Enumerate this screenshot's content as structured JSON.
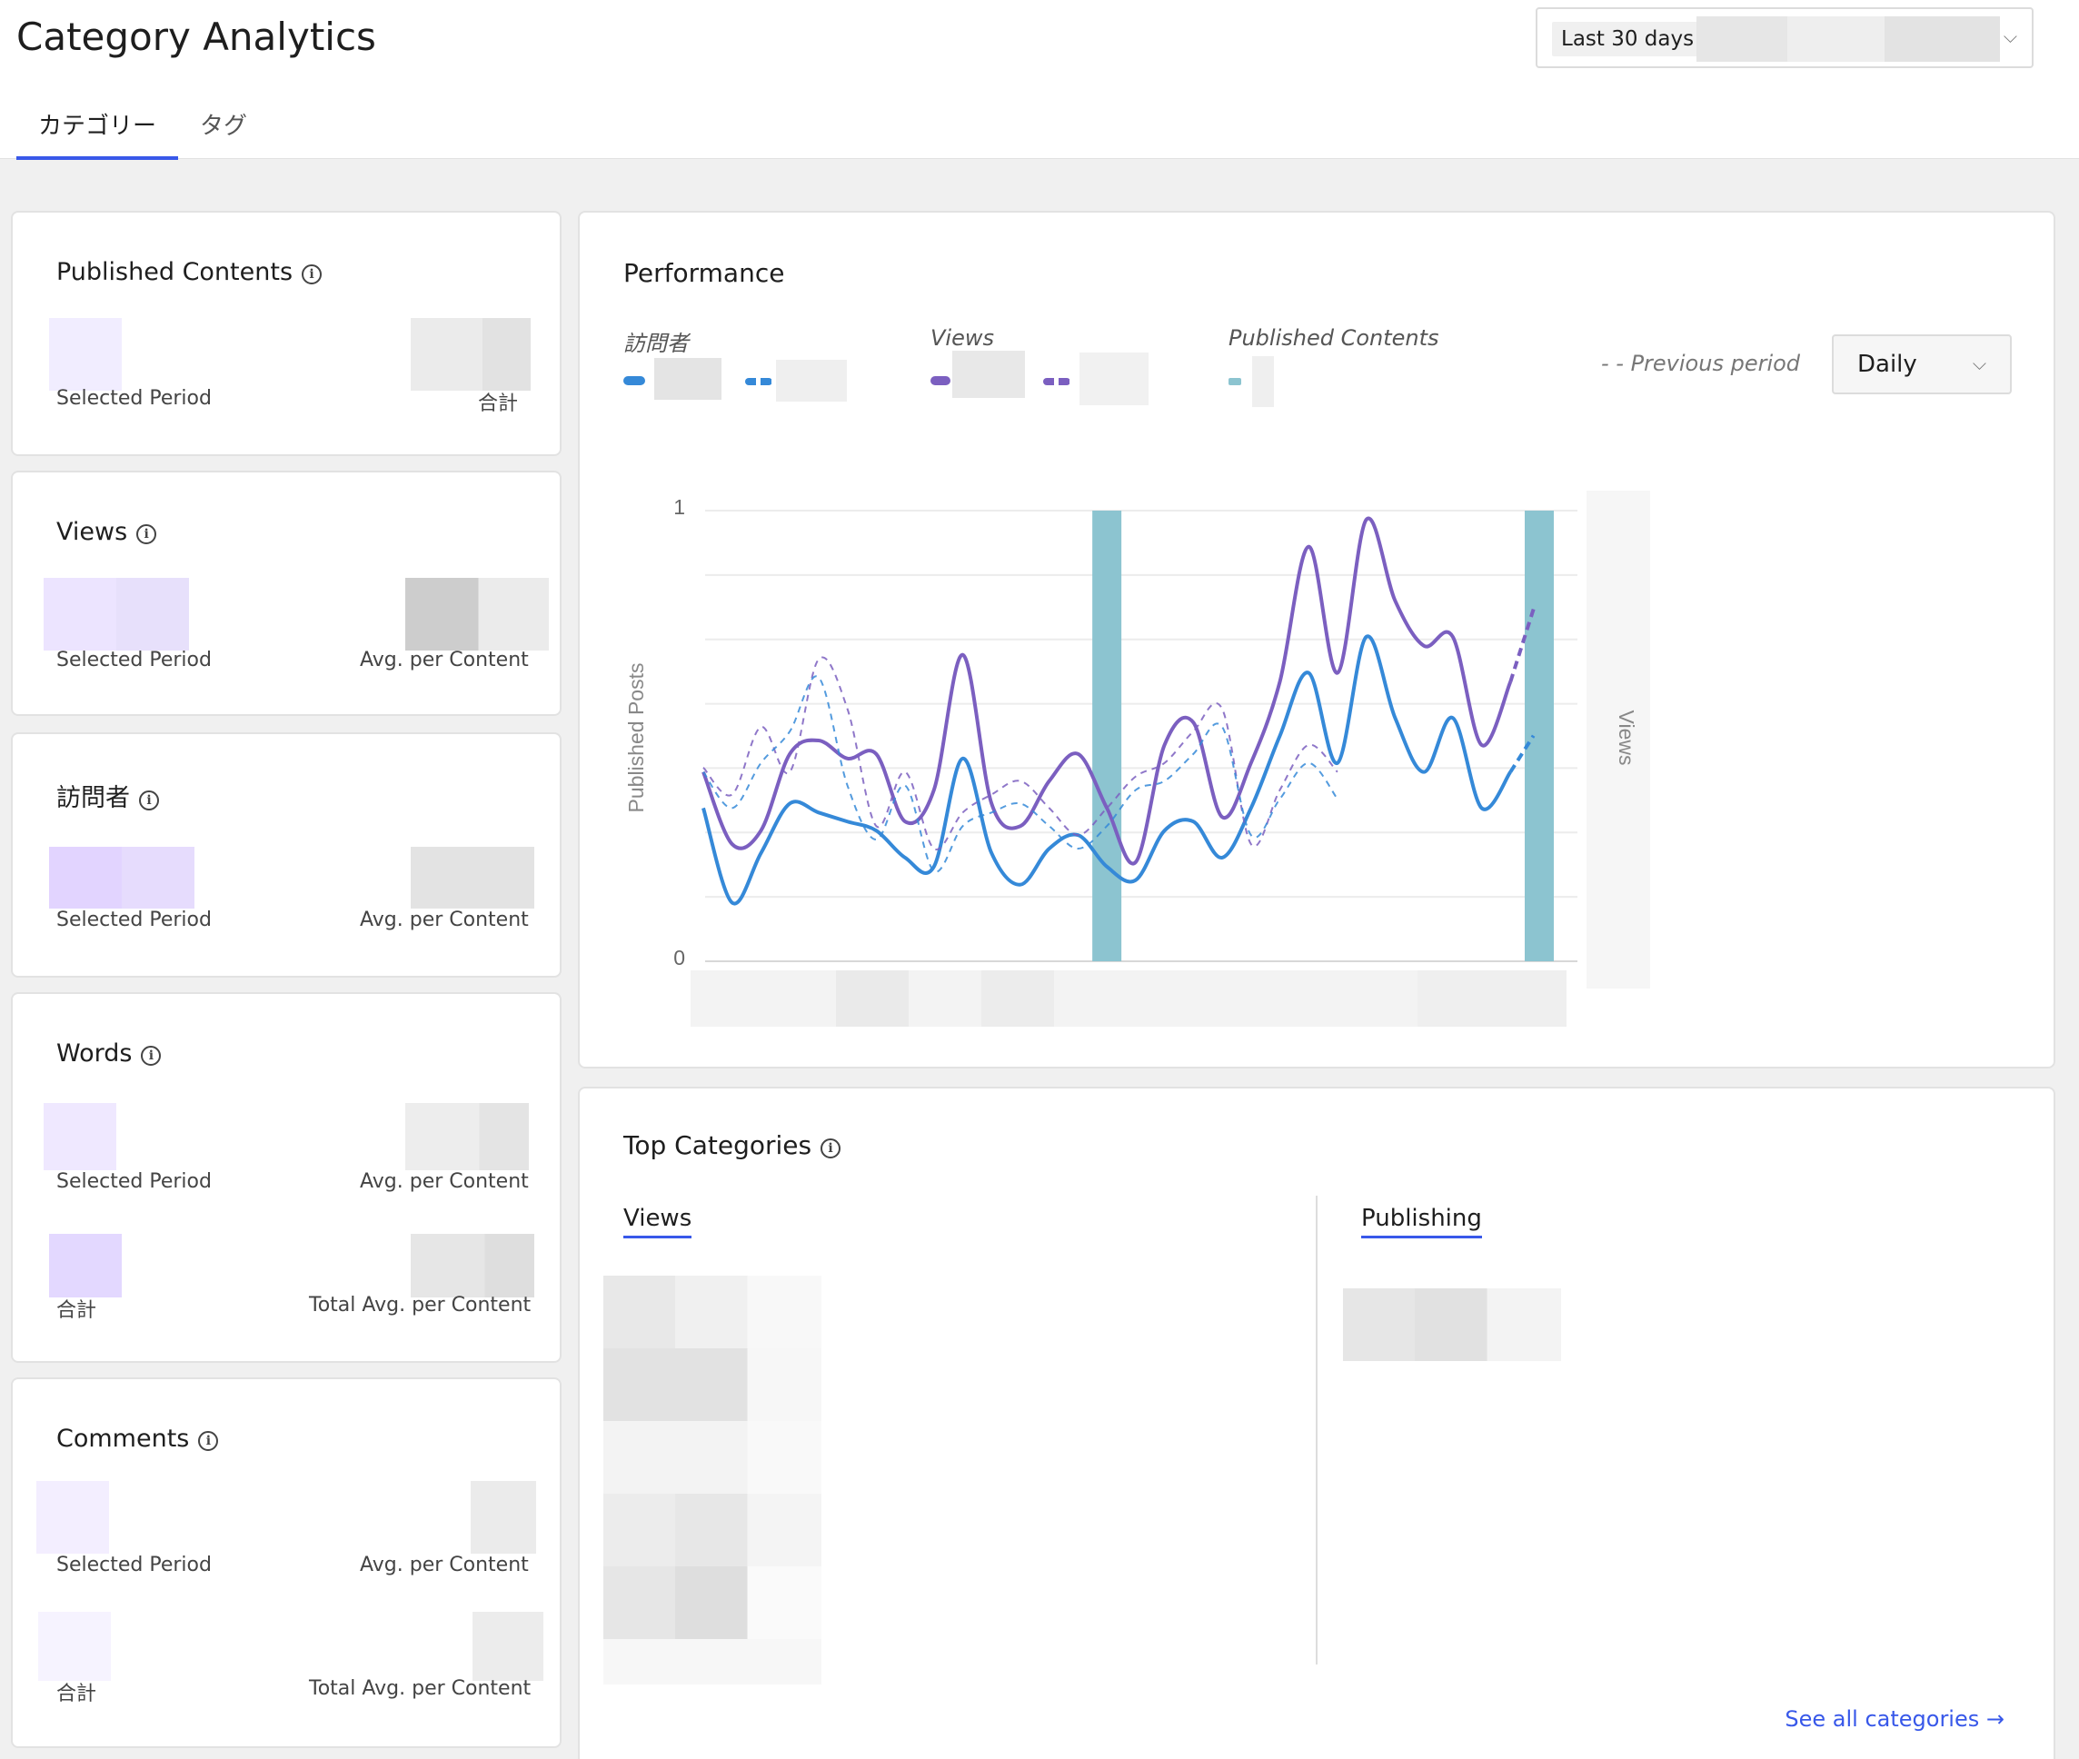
{
  "header": {
    "title": "Category Analytics",
    "date_range": {
      "chip": "Last 30 days",
      "chevron_icon": "chevron-down-icon"
    },
    "tabs": [
      {
        "label": "カテゴリー",
        "active": true
      },
      {
        "label": "タグ",
        "active": false
      }
    ]
  },
  "cards": {
    "published_contents": {
      "title": "Published Contents",
      "info_icon": "info-icon",
      "labels": {
        "left": "Selected Period",
        "right": "合計"
      }
    },
    "views": {
      "title": "Views",
      "info_icon": "info-icon",
      "labels": {
        "left": "Selected Period",
        "right": "Avg. per Content"
      }
    },
    "visitors": {
      "title": "訪問者",
      "info_icon": "info-icon",
      "labels": {
        "left": "Selected Period",
        "right": "Avg. per Content"
      }
    },
    "words": {
      "title": "Words",
      "info_icon": "info-icon",
      "labels": {
        "left1": "Selected Period",
        "right1": "Avg. per Content",
        "left2": "合計",
        "right2": "Total Avg. per Content"
      }
    },
    "comments": {
      "title": "Comments",
      "info_icon": "info-icon",
      "labels": {
        "left1": "Selected Period",
        "right1": "Avg. per Content",
        "left2": "合計",
        "right2": "Total Avg. per Content"
      }
    }
  },
  "performance": {
    "title": "Performance",
    "legend": {
      "visitors": "訪問者",
      "views": "Views",
      "published": "Published Contents",
      "previous_period": "- -  Previous period"
    },
    "period_select": {
      "value": "Daily",
      "chevron_icon": "chevron-down-icon"
    },
    "colors": {
      "visitors": "#3589d8",
      "views": "#7b5fc0",
      "published": "#8cc4d0"
    }
  },
  "chart_data": {
    "type": "line",
    "ylabel": "Published Posts",
    "y2label": "Views",
    "ylim": [
      0,
      1
    ],
    "ytick_labels": [
      "0",
      "1"
    ],
    "grid": true,
    "x": [
      0,
      1,
      2,
      3,
      4,
      5,
      6,
      7,
      8,
      9,
      10,
      11,
      12,
      13,
      14,
      15,
      16,
      17,
      18,
      19,
      20,
      21,
      22,
      23,
      24,
      25,
      26,
      27,
      28,
      29
    ],
    "series": [
      {
        "name": "Published Contents",
        "kind": "bar",
        "values": [
          0,
          0,
          0,
          0,
          0,
          0,
          0,
          0,
          0,
          0,
          0,
          0,
          0,
          0,
          1,
          0,
          0,
          0,
          0,
          0,
          0,
          0,
          0,
          0,
          0,
          0,
          0,
          0,
          0,
          1
        ]
      },
      {
        "name": "Views",
        "kind": "line",
        "values": [
          0.42,
          0.26,
          0.29,
          0.46,
          0.49,
          0.45,
          0.46,
          0.31,
          0.38,
          0.68,
          0.35,
          0.3,
          0.4,
          0.46,
          0.34,
          0.22,
          0.48,
          0.53,
          0.32,
          0.44,
          0.62,
          0.92,
          0.64,
          0.98,
          0.8,
          0.7,
          0.72,
          0.48,
          0.62
        ]
      },
      {
        "name": "訪問者",
        "kind": "line",
        "values": [
          0.34,
          0.13,
          0.24,
          0.35,
          0.33,
          0.31,
          0.29,
          0.23,
          0.21,
          0.45,
          0.24,
          0.17,
          0.25,
          0.28,
          0.21,
          0.18,
          0.29,
          0.31,
          0.23,
          0.34,
          0.5,
          0.64,
          0.44,
          0.72,
          0.54,
          0.42,
          0.54,
          0.34,
          0.42
        ]
      },
      {
        "name": "Views (previous period)",
        "kind": "dashed",
        "values": [
          0.43,
          0.37,
          0.52,
          0.42,
          0.67,
          0.56,
          0.3,
          0.42,
          0.25,
          0.33,
          0.37,
          0.4,
          0.34,
          0.28,
          0.34,
          0.41,
          0.44,
          0.51,
          0.56,
          0.26,
          0.38,
          0.48,
          0.42
        ]
      },
      {
        "name": "訪問者 (previous period)",
        "kind": "dashed",
        "values": [
          0.42,
          0.34,
          0.44,
          0.51,
          0.63,
          0.39,
          0.27,
          0.39,
          0.2,
          0.3,
          0.33,
          0.35,
          0.3,
          0.25,
          0.3,
          0.38,
          0.4,
          0.46,
          0.52,
          0.28,
          0.36,
          0.44,
          0.36
        ]
      }
    ]
  },
  "top_categories": {
    "title": "Top Categories",
    "info_icon": "info-icon",
    "tabs": {
      "views": "Views",
      "publishing": "Publishing"
    },
    "see_all": "See all categories",
    "see_all_icon": "arrow-right-icon"
  }
}
